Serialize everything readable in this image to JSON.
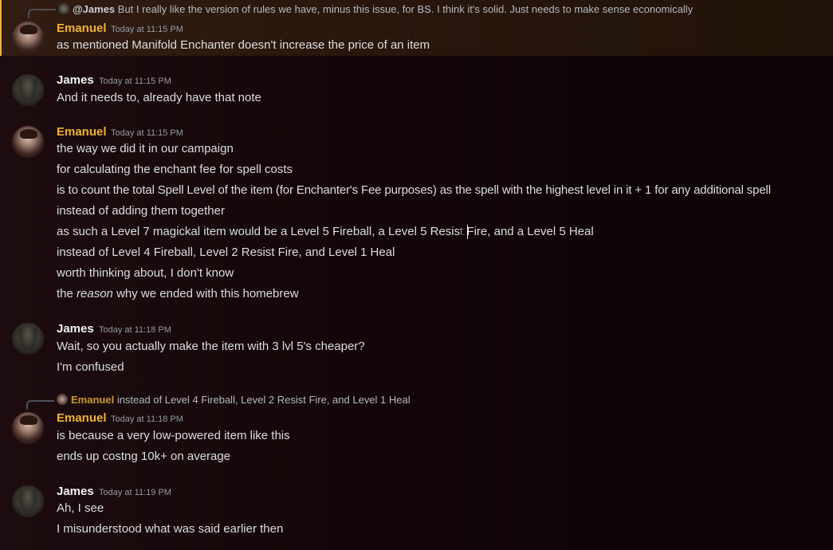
{
  "messages": [
    {
      "author": "Emanuel",
      "timestamp": "Today at 11:15 PM",
      "reply": {
        "mention": "@James",
        "text": "But I really like the version of rules we have, minus this issue, for BS. I think it's solid. Just needs to make sense economically"
      },
      "lines": [
        "as mentioned Manifold Enchanter doesn't increase the price of an item"
      ]
    },
    {
      "author": "James",
      "timestamp": "Today at 11:15 PM",
      "lines": [
        "And it needs to, already have that note"
      ]
    },
    {
      "author": "Emanuel",
      "timestamp": "Today at 11:15 PM",
      "lines": [
        "the way we did it in our campaign",
        "for calculating the enchant fee for spell costs",
        "is to count the total Spell Level of the item (for Enchanter's Fee purposes) as the spell with the highest level in it + 1 for any additional spell",
        "instead of adding them together",
        "as such a Level 7 magickal item would be a Level 5 Fireball, a Level 5 Resist Fire, and a Level 5 Heal",
        "instead of Level 4 Fireball, Level 2 Resist Fire, and Level 1 Heal",
        "worth thinking about, I don't know"
      ],
      "last_line": {
        "pre": "the ",
        "emph": "reason",
        "post": " why we ended with this homebrew"
      }
    },
    {
      "author": "James",
      "timestamp": "Today at 11:18 PM",
      "lines": [
        "Wait, so you actually make the item with 3 lvl 5's cheaper?",
        "I'm confused"
      ]
    },
    {
      "author": "Emanuel",
      "timestamp": "Today at 11:18 PM",
      "reply": {
        "author": "Emanuel",
        "text": "instead of Level 4 Fireball, Level 2 Resist Fire, and Level 1 Heal"
      },
      "lines": [
        "is because a very low-powered item like this",
        "ends up costng 10k+ on average"
      ]
    },
    {
      "author": "James",
      "timestamp": "Today at 11:19 PM",
      "lines": [
        "Ah, I see",
        "I misunderstood what was said earlier then"
      ]
    }
  ],
  "colors": {
    "emanuel_name": "#f0b232",
    "james_name": "#f2f3f5",
    "highlight_border": "#f0b232",
    "text": "#dbdee1",
    "timestamp": "#949ba4"
  }
}
